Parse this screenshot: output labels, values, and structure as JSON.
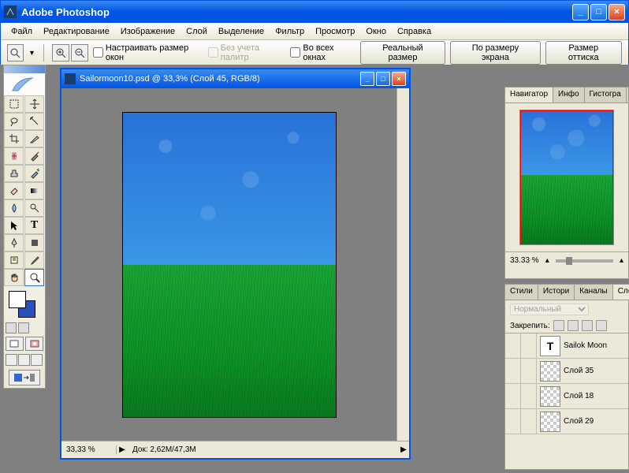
{
  "app": {
    "title": "Adobe Photoshop"
  },
  "menubar": [
    "Файл",
    "Редактирование",
    "Изображение",
    "Слой",
    "Выделение",
    "Фильтр",
    "Просмотр",
    "Окно",
    "Справка"
  ],
  "optbar": {
    "chk_resize": "Настраивать размер окон",
    "chk_ignore": "Без учета палитр",
    "chk_allwin": "Во всех окнах",
    "btn_actual": "Реальный размер",
    "btn_fit": "По размеру экрана",
    "btn_print": "Размер оттиска"
  },
  "document": {
    "title": "Sailormoon10.psd @ 33,3% (Слой 45, RGB/8)",
    "zoom": "33,33 %",
    "docinfo": "Док: 2,62M/47,3M"
  },
  "navigator": {
    "tabs": [
      "Навигатор",
      "Инфо",
      "Гистогра"
    ],
    "zoom": "33.33 %"
  },
  "layers": {
    "tabs": [
      "Стили",
      "Истори",
      "Каналы",
      "Слои"
    ],
    "blend": "Нормальный",
    "lock_label": "Закрепить:",
    "items": [
      {
        "name": "Sailok Moon",
        "type": "text"
      },
      {
        "name": "Слой 35",
        "type": "raster"
      },
      {
        "name": "Слой 18",
        "type": "raster"
      },
      {
        "name": "Слой 29",
        "type": "raster"
      }
    ]
  }
}
